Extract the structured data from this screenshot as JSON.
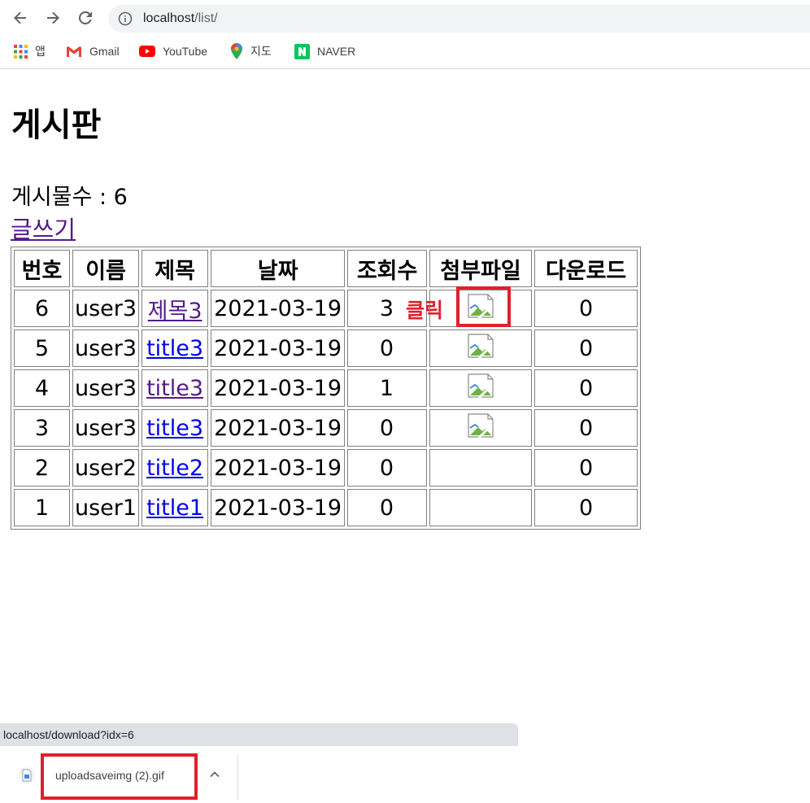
{
  "browser": {
    "url_host": "localhost",
    "url_path": "/list/",
    "bookmarks": [
      {
        "label": "앱",
        "icon": "apps-grid-icon"
      },
      {
        "label": "Gmail",
        "icon": "gmail-icon"
      },
      {
        "label": "YouTube",
        "icon": "youtube-icon"
      },
      {
        "label": "지도",
        "icon": "maps-pin-icon"
      },
      {
        "label": "NAVER",
        "icon": "naver-icon"
      }
    ]
  },
  "page": {
    "title": "게시판",
    "post_count": "게시물수 : 6",
    "write_link": "글쓰기"
  },
  "table": {
    "headers": [
      "번호",
      "이름",
      "제목",
      "날짜",
      "조회수",
      "첨부파일",
      "다운로드"
    ],
    "rows": [
      {
        "no": "6",
        "name": "user3",
        "title": "제목3",
        "date": "2021-03-19",
        "views": "3",
        "has_file": true,
        "downloads": "0",
        "visited": true
      },
      {
        "no": "5",
        "name": "user3",
        "title": "title3",
        "date": "2021-03-19",
        "views": "0",
        "has_file": true,
        "downloads": "0",
        "visited": false
      },
      {
        "no": "4",
        "name": "user3",
        "title": "title3",
        "date": "2021-03-19",
        "views": "1",
        "has_file": true,
        "downloads": "0",
        "visited": true
      },
      {
        "no": "3",
        "name": "user3",
        "title": "title3",
        "date": "2021-03-19",
        "views": "0",
        "has_file": true,
        "downloads": "0",
        "visited": false
      },
      {
        "no": "2",
        "name": "user2",
        "title": "title2",
        "date": "2021-03-19",
        "views": "0",
        "has_file": false,
        "downloads": "0",
        "visited": false
      },
      {
        "no": "1",
        "name": "user1",
        "title": "title1",
        "date": "2021-03-19",
        "views": "0",
        "has_file": false,
        "downloads": "0",
        "visited": false
      }
    ]
  },
  "annotation": {
    "label": "클릭",
    "color": "#e0202c"
  },
  "status_bar": {
    "text": "localhost/download?idx=6"
  },
  "download_shelf": {
    "filename": "uploadsaveimg (2).gif"
  },
  "colors": {
    "link_visited": "#551a8b",
    "link_new": "#0000ee"
  }
}
